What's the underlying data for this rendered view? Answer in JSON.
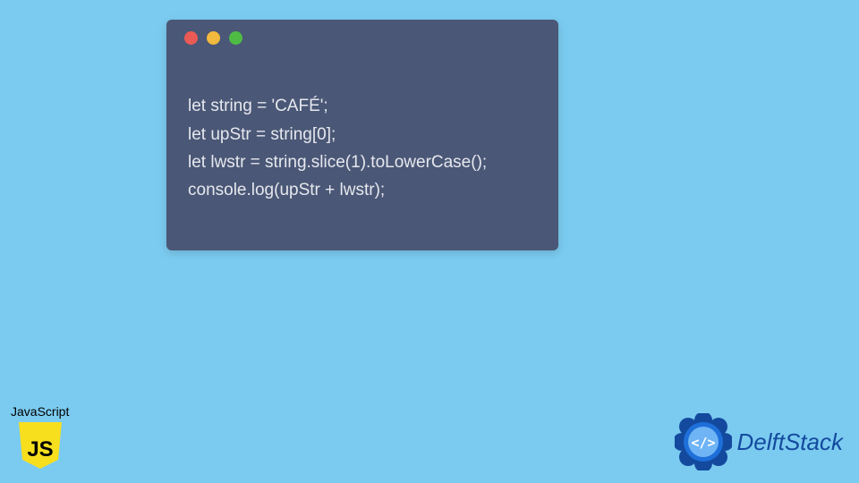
{
  "code_window": {
    "lines": [
      "let string = 'CAFÉ';",
      "let upStr = string[0];",
      "let lwstr = string.slice(1).toLowerCase();",
      "console.log(upStr + lwstr);"
    ]
  },
  "js_badge": {
    "label": "JavaScript",
    "shield_text": "JS",
    "shield_bg": "#f7df1e",
    "shield_fg": "#000000"
  },
  "brand": {
    "name": "DelftStack",
    "logo_glyph": "</>",
    "accent": "#134a9e",
    "accent2": "#1e6fd9"
  }
}
